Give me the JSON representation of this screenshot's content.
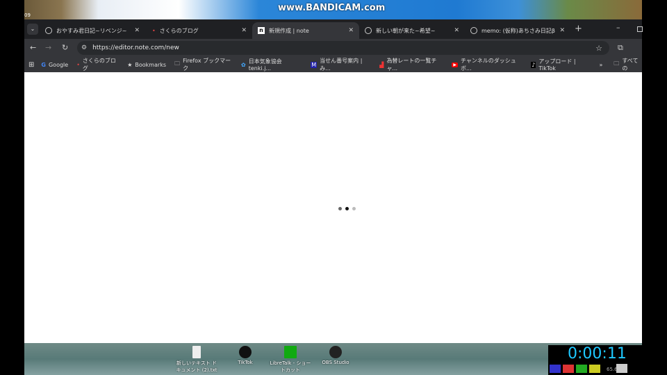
{
  "overlay": {
    "watermark": "www.BANDICAM.com",
    "corner_number": "09"
  },
  "tabs": [
    {
      "title": "おやすみ君日記~リベンジ~",
      "active": false
    },
    {
      "title": "さくらのブログ",
      "active": false
    },
    {
      "title": "新規作成 | note",
      "active": true
    },
    {
      "title": "新しい朝が来た~希望~",
      "active": false
    },
    {
      "title": "memo: (仮称)あちさみ日記β",
      "active": false
    }
  ],
  "toolbar": {
    "url": "https://editor.note.com/new"
  },
  "bookmarks": [
    {
      "label": "Google",
      "icon": "google-icon"
    },
    {
      "label": "さくらのブログ",
      "icon": "sakura-icon"
    },
    {
      "label": "Bookmarks",
      "icon": "star-icon"
    },
    {
      "label": "Firefox ブックマーク",
      "icon": "folder-icon"
    },
    {
      "label": "日本気象協会 tenki.j...",
      "icon": "tenki-icon"
    },
    {
      "label": "当せん番号案内 | み...",
      "icon": "mizuho-icon"
    },
    {
      "label": "為替レートの一覧チャ...",
      "icon": "chart-icon"
    },
    {
      "label": "チャンネルのダッシュボ...",
      "icon": "youtube-icon"
    },
    {
      "label": "アップロード | TikTok",
      "icon": "tiktok-icon"
    }
  ],
  "all_bookmarks": "すべての",
  "desktop_icons": [
    {
      "label": "新しいテキスト ドキュメント (2).txt"
    },
    {
      "label": "TikTok"
    },
    {
      "label": "LibreTalk - ショートカット"
    },
    {
      "label": "OBS Studio"
    }
  ],
  "recorder": {
    "time": "0:00:11",
    "size": "65.6"
  }
}
